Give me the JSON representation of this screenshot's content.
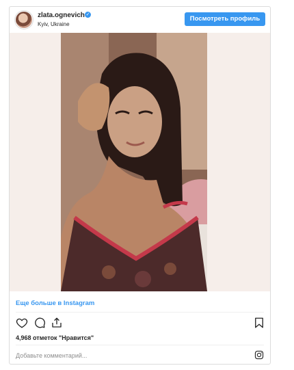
{
  "post": {
    "username": "zlata.ognevich",
    "location": "Kyiv, Ukraine",
    "profile_button": "Посмотреть профиль",
    "more_link": "Еще больше в Instagram",
    "likes_text": "4,968 отметок \"Нравится\"",
    "comment_placeholder": "Добавьте комментарий..."
  },
  "icons": {
    "verified": "verified-badge-icon",
    "like": "heart-icon",
    "comment": "comment-icon",
    "share": "share-icon",
    "save": "bookmark-icon",
    "instagram": "instagram-logo-icon"
  },
  "colors": {
    "accent": "#3897f0",
    "border": "#dbdbdb",
    "text": "#262626",
    "muted": "#8e8e8e"
  }
}
